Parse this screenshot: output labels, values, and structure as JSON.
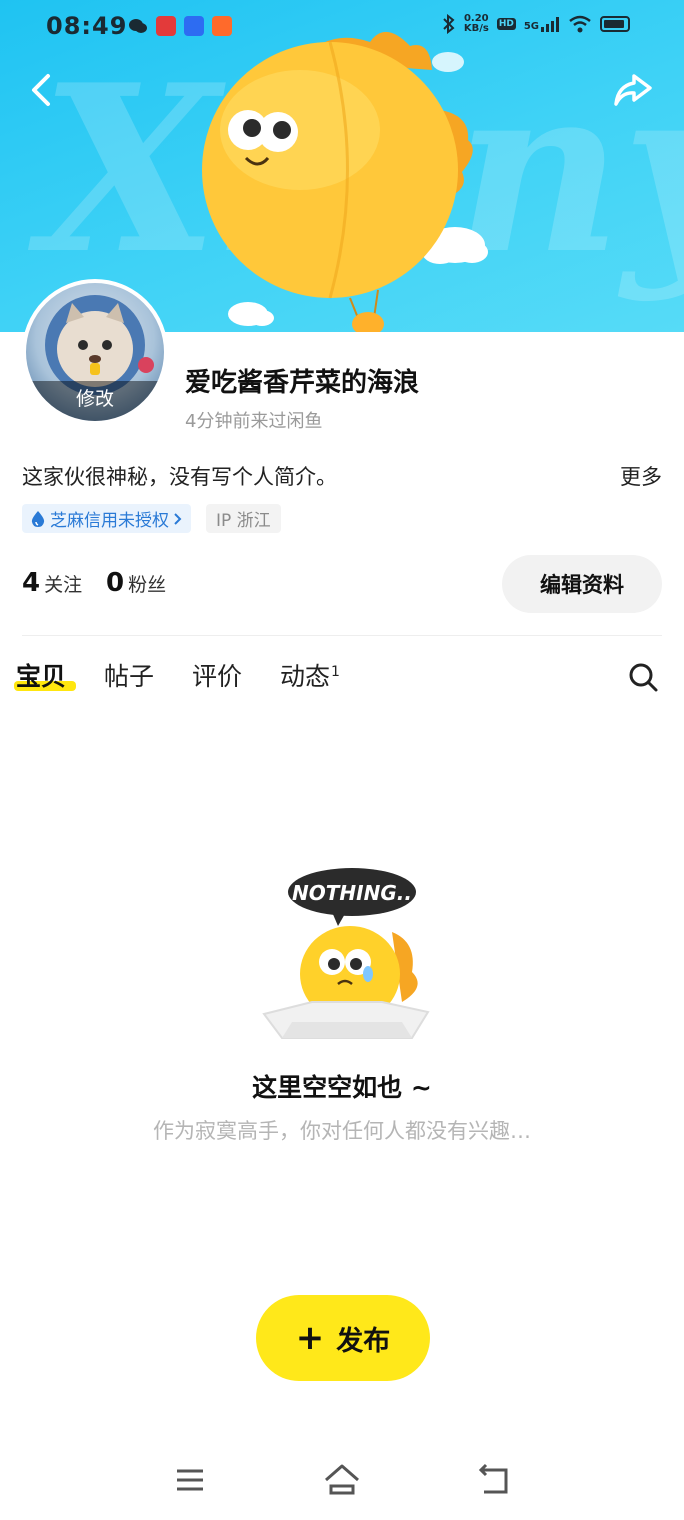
{
  "status_bar": {
    "time": "08:49",
    "net_speed_value": "0.20",
    "net_speed_unit": "KB/s",
    "hd_label": "HD",
    "network_label": "5G"
  },
  "profile": {
    "avatar_edit_label": "修改",
    "nickname": "爱吃酱香芹菜的海浪",
    "last_seen": "4分钟前来过闲鱼",
    "bio": "这家伙很神秘，没有写个人简介。",
    "more_label": "更多",
    "credit_badge": "芝麻信用未授权",
    "ip_label": "IP 浙江",
    "following_count": "4",
    "following_label": "关注",
    "followers_count": "0",
    "followers_label": "粉丝",
    "edit_profile_label": "编辑资料"
  },
  "tabs": [
    {
      "label": "宝贝",
      "active": true
    },
    {
      "label": "帖子",
      "active": false
    },
    {
      "label": "评价",
      "active": false
    },
    {
      "label": "动态",
      "active": false,
      "superscript": "1"
    }
  ],
  "empty_state": {
    "bubble_text": "NOTHING..",
    "title": "这里空空如也 ~",
    "subtitle": "作为寂寞高手，你对任何人都没有兴趣…"
  },
  "publish": {
    "label": "发布"
  },
  "banner": {
    "watermark": "Xianyu"
  },
  "colors": {
    "accent_yellow": "#ffe81a",
    "banner_blue": "#3fd2f6",
    "credit_blue": "#2a7ad6"
  }
}
